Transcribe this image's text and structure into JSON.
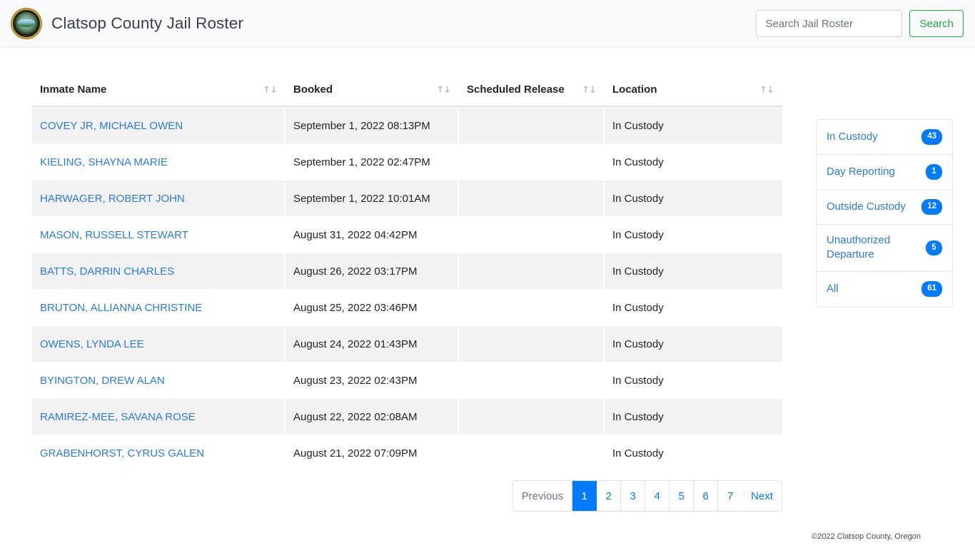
{
  "header": {
    "brand_title": "Clatsop County Jail Roster",
    "logo_name": "clatsop-county-seal",
    "search": {
      "placeholder": "Search Jail Roster",
      "value": "",
      "button_label": "Search"
    }
  },
  "table": {
    "columns": [
      {
        "key": "name",
        "label": "Inmate Name",
        "sort_icon": "↑↓"
      },
      {
        "key": "booked",
        "label": "Booked",
        "sort_icon": "↑↓"
      },
      {
        "key": "released",
        "label": "Scheduled Release",
        "sort_icon": "↑↓"
      },
      {
        "key": "location",
        "label": "Location",
        "sort_icon": "↑↓"
      }
    ],
    "rows": [
      {
        "name": "COVEY JR, MICHAEL OWEN",
        "booked": "September 1, 2022 08:13PM",
        "released": "",
        "location": "In Custody"
      },
      {
        "name": "KIELING, SHAYNA MARIE",
        "booked": "September 1, 2022 02:47PM",
        "released": "",
        "location": "In Custody"
      },
      {
        "name": "HARWAGER, ROBERT JOHN",
        "booked": "September 1, 2022 10:01AM",
        "released": "",
        "location": "In Custody"
      },
      {
        "name": "MASON, RUSSELL STEWART",
        "booked": "August 31, 2022 04:42PM",
        "released": "",
        "location": "In Custody"
      },
      {
        "name": "BATTS, DARRIN CHARLES",
        "booked": "August 26, 2022 03:17PM",
        "released": "",
        "location": "In Custody"
      },
      {
        "name": "BRUTON, ALLIANNA CHRISTINE",
        "booked": "August 25, 2022 03:46PM",
        "released": "",
        "location": "In Custody"
      },
      {
        "name": "OWENS, LYNDA LEE",
        "booked": "August 24, 2022 01:43PM",
        "released": "",
        "location": "In Custody"
      },
      {
        "name": "BYINGTON, DREW ALAN",
        "booked": "August 23, 2022 02:43PM",
        "released": "",
        "location": "In Custody"
      },
      {
        "name": "RAMIREZ-MEE, SAVANA ROSE",
        "booked": "August 22, 2022 02:08AM",
        "released": "",
        "location": "In Custody"
      },
      {
        "name": "GRABENHORST, CYRUS GALEN",
        "booked": "August 21, 2022 07:09PM",
        "released": "",
        "location": "In Custody"
      }
    ]
  },
  "pagination": {
    "previous_label": "Previous",
    "next_label": "Next",
    "pages": [
      "1",
      "2",
      "3",
      "4",
      "5",
      "6",
      "7"
    ],
    "active_page": "1",
    "previous_disabled": true
  },
  "filters": {
    "items": [
      {
        "label": "In Custody",
        "count": "43"
      },
      {
        "label": "Day Reporting",
        "count": "1"
      },
      {
        "label": "Outside Custody",
        "count": "12"
      },
      {
        "label": "Unauthorized Departure",
        "count": "5"
      },
      {
        "label": "All",
        "count": "61"
      }
    ]
  },
  "footer": {
    "copyright": "©2022 Clatsop County, Oregon"
  },
  "colors": {
    "link": "#2a7ae2",
    "badge": "#007bff",
    "active_page": "#007bff",
    "search_button": "#28a745",
    "navbar_bg": "#f8f9fa",
    "stripe": "#f2f2f2"
  }
}
